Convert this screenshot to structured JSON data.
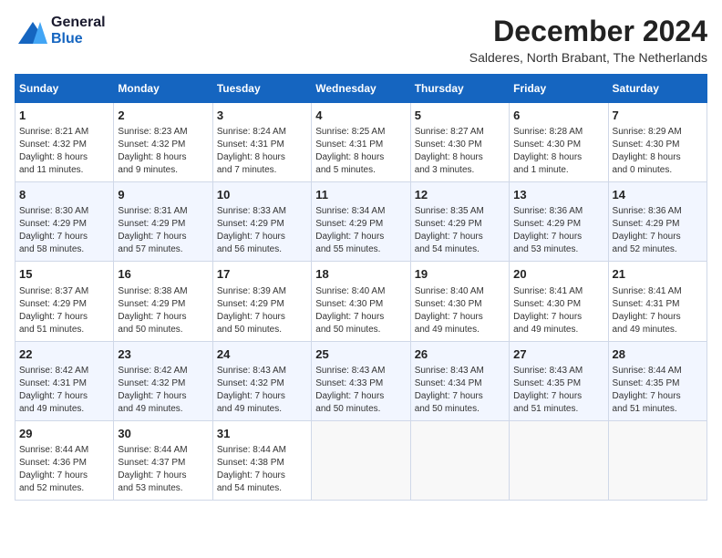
{
  "logo": {
    "text_general": "General",
    "text_blue": "Blue"
  },
  "title": "December 2024",
  "subtitle": "Salderes, North Brabant, The Netherlands",
  "headers": [
    "Sunday",
    "Monday",
    "Tuesday",
    "Wednesday",
    "Thursday",
    "Friday",
    "Saturday"
  ],
  "weeks": [
    [
      {
        "day": "1",
        "info": "Sunrise: 8:21 AM\nSunset: 4:32 PM\nDaylight: 8 hours\nand 11 minutes."
      },
      {
        "day": "2",
        "info": "Sunrise: 8:23 AM\nSunset: 4:32 PM\nDaylight: 8 hours\nand 9 minutes."
      },
      {
        "day": "3",
        "info": "Sunrise: 8:24 AM\nSunset: 4:31 PM\nDaylight: 8 hours\nand 7 minutes."
      },
      {
        "day": "4",
        "info": "Sunrise: 8:25 AM\nSunset: 4:31 PM\nDaylight: 8 hours\nand 5 minutes."
      },
      {
        "day": "5",
        "info": "Sunrise: 8:27 AM\nSunset: 4:30 PM\nDaylight: 8 hours\nand 3 minutes."
      },
      {
        "day": "6",
        "info": "Sunrise: 8:28 AM\nSunset: 4:30 PM\nDaylight: 8 hours\nand 1 minute."
      },
      {
        "day": "7",
        "info": "Sunrise: 8:29 AM\nSunset: 4:30 PM\nDaylight: 8 hours\nand 0 minutes."
      }
    ],
    [
      {
        "day": "8",
        "info": "Sunrise: 8:30 AM\nSunset: 4:29 PM\nDaylight: 7 hours\nand 58 minutes."
      },
      {
        "day": "9",
        "info": "Sunrise: 8:31 AM\nSunset: 4:29 PM\nDaylight: 7 hours\nand 57 minutes."
      },
      {
        "day": "10",
        "info": "Sunrise: 8:33 AM\nSunset: 4:29 PM\nDaylight: 7 hours\nand 56 minutes."
      },
      {
        "day": "11",
        "info": "Sunrise: 8:34 AM\nSunset: 4:29 PM\nDaylight: 7 hours\nand 55 minutes."
      },
      {
        "day": "12",
        "info": "Sunrise: 8:35 AM\nSunset: 4:29 PM\nDaylight: 7 hours\nand 54 minutes."
      },
      {
        "day": "13",
        "info": "Sunrise: 8:36 AM\nSunset: 4:29 PM\nDaylight: 7 hours\nand 53 minutes."
      },
      {
        "day": "14",
        "info": "Sunrise: 8:36 AM\nSunset: 4:29 PM\nDaylight: 7 hours\nand 52 minutes."
      }
    ],
    [
      {
        "day": "15",
        "info": "Sunrise: 8:37 AM\nSunset: 4:29 PM\nDaylight: 7 hours\nand 51 minutes."
      },
      {
        "day": "16",
        "info": "Sunrise: 8:38 AM\nSunset: 4:29 PM\nDaylight: 7 hours\nand 50 minutes."
      },
      {
        "day": "17",
        "info": "Sunrise: 8:39 AM\nSunset: 4:29 PM\nDaylight: 7 hours\nand 50 minutes."
      },
      {
        "day": "18",
        "info": "Sunrise: 8:40 AM\nSunset: 4:30 PM\nDaylight: 7 hours\nand 50 minutes."
      },
      {
        "day": "19",
        "info": "Sunrise: 8:40 AM\nSunset: 4:30 PM\nDaylight: 7 hours\nand 49 minutes."
      },
      {
        "day": "20",
        "info": "Sunrise: 8:41 AM\nSunset: 4:30 PM\nDaylight: 7 hours\nand 49 minutes."
      },
      {
        "day": "21",
        "info": "Sunrise: 8:41 AM\nSunset: 4:31 PM\nDaylight: 7 hours\nand 49 minutes."
      }
    ],
    [
      {
        "day": "22",
        "info": "Sunrise: 8:42 AM\nSunset: 4:31 PM\nDaylight: 7 hours\nand 49 minutes."
      },
      {
        "day": "23",
        "info": "Sunrise: 8:42 AM\nSunset: 4:32 PM\nDaylight: 7 hours\nand 49 minutes."
      },
      {
        "day": "24",
        "info": "Sunrise: 8:43 AM\nSunset: 4:32 PM\nDaylight: 7 hours\nand 49 minutes."
      },
      {
        "day": "25",
        "info": "Sunrise: 8:43 AM\nSunset: 4:33 PM\nDaylight: 7 hours\nand 50 minutes."
      },
      {
        "day": "26",
        "info": "Sunrise: 8:43 AM\nSunset: 4:34 PM\nDaylight: 7 hours\nand 50 minutes."
      },
      {
        "day": "27",
        "info": "Sunrise: 8:43 AM\nSunset: 4:35 PM\nDaylight: 7 hours\nand 51 minutes."
      },
      {
        "day": "28",
        "info": "Sunrise: 8:44 AM\nSunset: 4:35 PM\nDaylight: 7 hours\nand 51 minutes."
      }
    ],
    [
      {
        "day": "29",
        "info": "Sunrise: 8:44 AM\nSunset: 4:36 PM\nDaylight: 7 hours\nand 52 minutes."
      },
      {
        "day": "30",
        "info": "Sunrise: 8:44 AM\nSunset: 4:37 PM\nDaylight: 7 hours\nand 53 minutes."
      },
      {
        "day": "31",
        "info": "Sunrise: 8:44 AM\nSunset: 4:38 PM\nDaylight: 7 hours\nand 54 minutes."
      },
      null,
      null,
      null,
      null
    ]
  ]
}
